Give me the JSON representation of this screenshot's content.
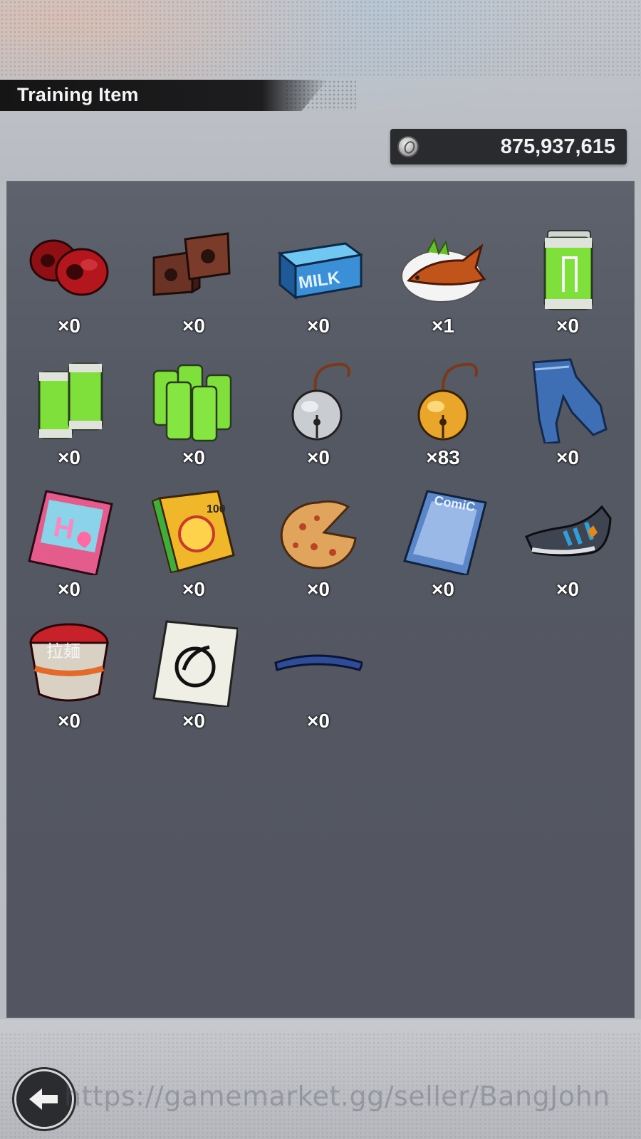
{
  "header": {
    "title": "Training Item"
  },
  "currency": {
    "icon": "coin-icon",
    "value": "875,937,615"
  },
  "items": [
    {
      "name": "red-weights-icon",
      "count": "×0"
    },
    {
      "name": "bricks-icon",
      "count": "×0"
    },
    {
      "name": "milk-carton-icon",
      "count": "×0"
    },
    {
      "name": "fish-dish-icon",
      "count": "×1"
    },
    {
      "name": "battery-icon",
      "count": "×0"
    },
    {
      "name": "battery-pair-icon",
      "count": "×0"
    },
    {
      "name": "battery-pack-icon",
      "count": "×0"
    },
    {
      "name": "silver-bell-icon",
      "count": "×0"
    },
    {
      "name": "gold-bell-icon",
      "count": "×83"
    },
    {
      "name": "jeans-icon",
      "count": "×0"
    },
    {
      "name": "pink-magazine-icon",
      "count": "×0"
    },
    {
      "name": "joke-book-icon",
      "count": "×0"
    },
    {
      "name": "pizza-icon",
      "count": "×0"
    },
    {
      "name": "comic-book-icon",
      "count": "×0"
    },
    {
      "name": "shoe-icon",
      "count": "×0"
    },
    {
      "name": "ramen-cup-icon",
      "count": "×0"
    },
    {
      "name": "symbol-card-icon",
      "count": "×0"
    },
    {
      "name": "blue-band-icon",
      "count": "×0"
    }
  ],
  "back_button": {
    "icon": "back-arrow-icon"
  },
  "watermark": "https://gamemarket.gg/seller/BangJohn"
}
